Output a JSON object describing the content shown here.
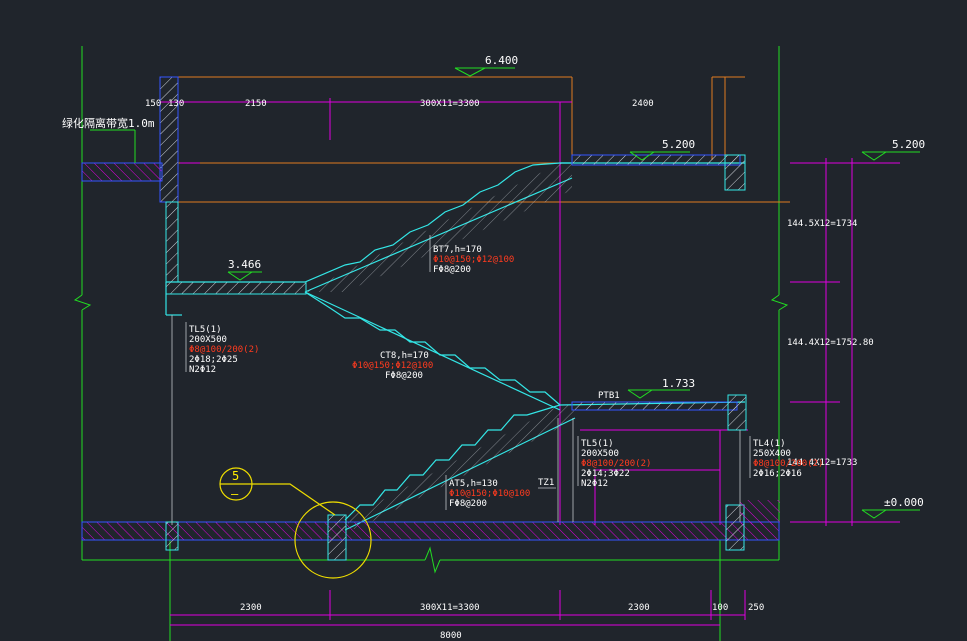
{
  "levels": {
    "top": "6.400",
    "l5200_inner": "5.200",
    "l5200_right": "5.200",
    "l3466": "3.466",
    "l1733": "1.733",
    "l0": "±0.000"
  },
  "note_left": "绿化隔离带宽1.0m",
  "top_dims": {
    "d150": "150",
    "d130": "130",
    "d2150": "2150",
    "d3300": "300X11=3300",
    "d2400": "2400"
  },
  "side_dims": {
    "d1734": "144.5X12=1734",
    "d1752": "144.4X12=1752.80",
    "d1733": "144.4X12=1733"
  },
  "bottom_dims": {
    "d2300a": "2300",
    "d3300": "300X11=3300",
    "d2300b": "2300",
    "d100": "100",
    "d250": "250",
    "d8000": "8000"
  },
  "stairs": {
    "bt7": {
      "l1": "BT7,h=170",
      "l2": "Φ10@150;Φ12@100",
      "l3": "FΦ8@200"
    },
    "ct8": {
      "l1": "CT8,h=170",
      "l2": "Φ10@150;Φ12@100",
      "l3": "FΦ8@200"
    },
    "at5": {
      "l1": "AT5,h=130",
      "l2": "Φ10@150;Φ10@100",
      "l3": "FΦ8@200"
    }
  },
  "beams": {
    "tl5_left": {
      "l1": "TL5(1)",
      "l2": "200X500",
      "l3": "Φ8@100/200(2)",
      "l4": "2Φ18;2Φ25",
      "l5": "N2Φ12"
    },
    "tl5_mid": {
      "l1": "TL5(1)",
      "l2": "200X500",
      "l3": "Φ8@100/200(2)",
      "l4": "2Φ14;3Φ22",
      "l5": "N2Φ12"
    },
    "tl4_right": {
      "l1": "TL4(1)",
      "l2": "250X400",
      "l3": "Φ8@100/200(2)",
      "l4": "2Φ16;2Φ16"
    }
  },
  "ptb": "PTB1",
  "tz": "TZ1",
  "detail": {
    "num": "5",
    "sub": "—"
  }
}
